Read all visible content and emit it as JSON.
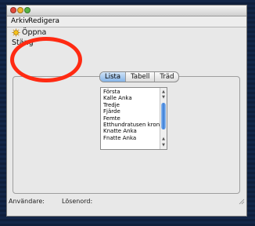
{
  "menubar": {
    "menus": [
      "Arkiv",
      "Redigera"
    ]
  },
  "file_menu": {
    "items": [
      {
        "label": "Öppna",
        "icon": "open-folder-icon"
      },
      {
        "label": "Stäng"
      }
    ]
  },
  "tabs": [
    "Lista",
    "Tabell",
    "Träd"
  ],
  "active_tab": "Lista",
  "list": {
    "items": [
      "Första",
      "Kalle Anka",
      "Tredje",
      "Fjärde",
      "Femte",
      "Etthundratusen kronor",
      "Knatte Anka",
      "Fnatte Anka"
    ]
  },
  "statusbar": {
    "user_label": "Användare:",
    "password_label": "Lösenord:"
  },
  "colors": {
    "accent": "#3a7ed8",
    "annotation": "#ff2a12",
    "desktop": "#132648"
  }
}
